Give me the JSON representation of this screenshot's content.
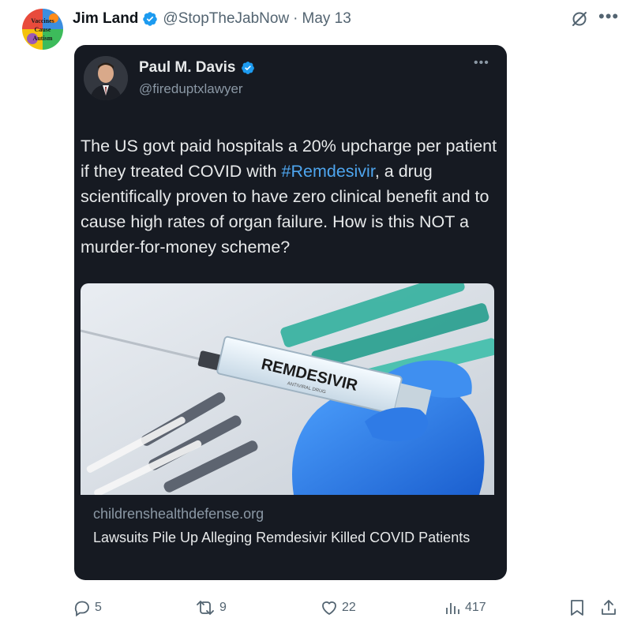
{
  "author": {
    "name": "Jim Land",
    "handle": "@StopTheJabNow",
    "separator": "·",
    "date": "May 13",
    "avatar_text": [
      "Vaccines",
      "Cause",
      "Autism"
    ]
  },
  "embedded": {
    "name": "Paul M. Davis",
    "handle": "@fireduptxlawyer",
    "text_before": "The US govt paid hospitals a 20% upcharge per patient if they treated COVID with ",
    "hashtag": "#Remdesivir",
    "text_after": ", a drug scientifically proven to have zero clinical benefit and to cause high rates of organ failure. How is this NOT a murder-for-money scheme?",
    "card": {
      "image_label": "REMDESIVIR",
      "image_sublabel": "ANTIVIRAL DRUG",
      "domain": "childrenshealthdefense.org",
      "title": "Lawsuits Pile Up Alleging Remdesivir Killed COVID Patients"
    }
  },
  "actions": {
    "replies": "5",
    "reposts": "9",
    "likes": "22",
    "views": "417"
  },
  "colors": {
    "verified": "#1d9bf0",
    "hashtag": "#4ea5ee",
    "muted": "#536471",
    "embed_bg": "#161a22"
  },
  "icons": [
    "grok-icon",
    "more-icon",
    "verified-badge-icon",
    "reply-icon",
    "repost-icon",
    "like-icon",
    "views-icon",
    "bookmark-icon",
    "share-icon"
  ]
}
